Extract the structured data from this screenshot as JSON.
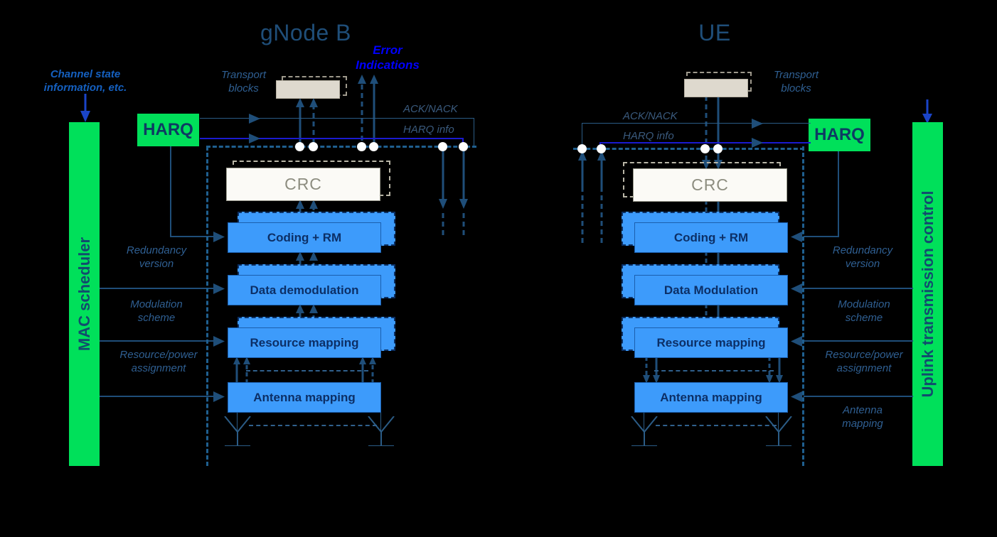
{
  "diagram": {
    "title_gnb": "gNode B",
    "title_ue": "UE",
    "error_indications": "Error\nIndications",
    "error_indications_l1": "Error",
    "error_indications_l2": "Indications",
    "colors": {
      "background": "#000000",
      "green_bar": "#00e05a",
      "process_box": "#3d9bfb",
      "process_text": "#0c2f66",
      "crc_box": "#fbfaf6",
      "crc_text": "#8d8d80",
      "transport_block": "#ded9ce",
      "line_blue": "#1f4e79",
      "royal_blue": "#1a1ad0",
      "label_blue": "#2f5f92",
      "title_blue": "#1f4e79",
      "error_blue": "#0000ff",
      "junction_dot": "#ffffff"
    }
  },
  "gnb": {
    "title": "gNode B",
    "scheduler_label": "MAC scheduler",
    "harq_label": "HARQ",
    "channel_state_l1": "Channel state",
    "channel_state_l2": "information, etc.",
    "transport_blocks_l1": "Transport",
    "transport_blocks_l2": "blocks",
    "acknack_label": "ACK/NACK",
    "harq_info_label": "HARQ info",
    "crc_label": "CRC",
    "boxes": [
      {
        "label": "Coding + RM"
      },
      {
        "label": "Data demodulation"
      },
      {
        "label": "Resource mapping"
      },
      {
        "label": "Antenna mapping"
      }
    ],
    "control_labels": [
      {
        "l1": "Redundancy",
        "l2": "version"
      },
      {
        "l1": "Modulation",
        "l2": "scheme"
      },
      {
        "l1": "Resource/power",
        "l2": "assignment"
      }
    ]
  },
  "ue": {
    "title": "UE",
    "control_label": "Uplink transmission control",
    "harq_label": "HARQ",
    "transport_blocks_l1": "Transport",
    "transport_blocks_l2": "blocks",
    "acknack_label": "ACK/NACK",
    "harq_info_label": "HARQ info",
    "crc_label": "CRC",
    "boxes": [
      {
        "label": "Coding + RM"
      },
      {
        "label": "Data Modulation"
      },
      {
        "label": "Resource mapping"
      },
      {
        "label": "Antenna mapping"
      }
    ],
    "control_labels": [
      {
        "l1": "Redundancy",
        "l2": "version"
      },
      {
        "l1": "Modulation",
        "l2": "scheme"
      },
      {
        "l1": "Resource/power",
        "l2": "assignment"
      },
      {
        "l1": "Antenna",
        "l2": "mapping"
      }
    ]
  }
}
